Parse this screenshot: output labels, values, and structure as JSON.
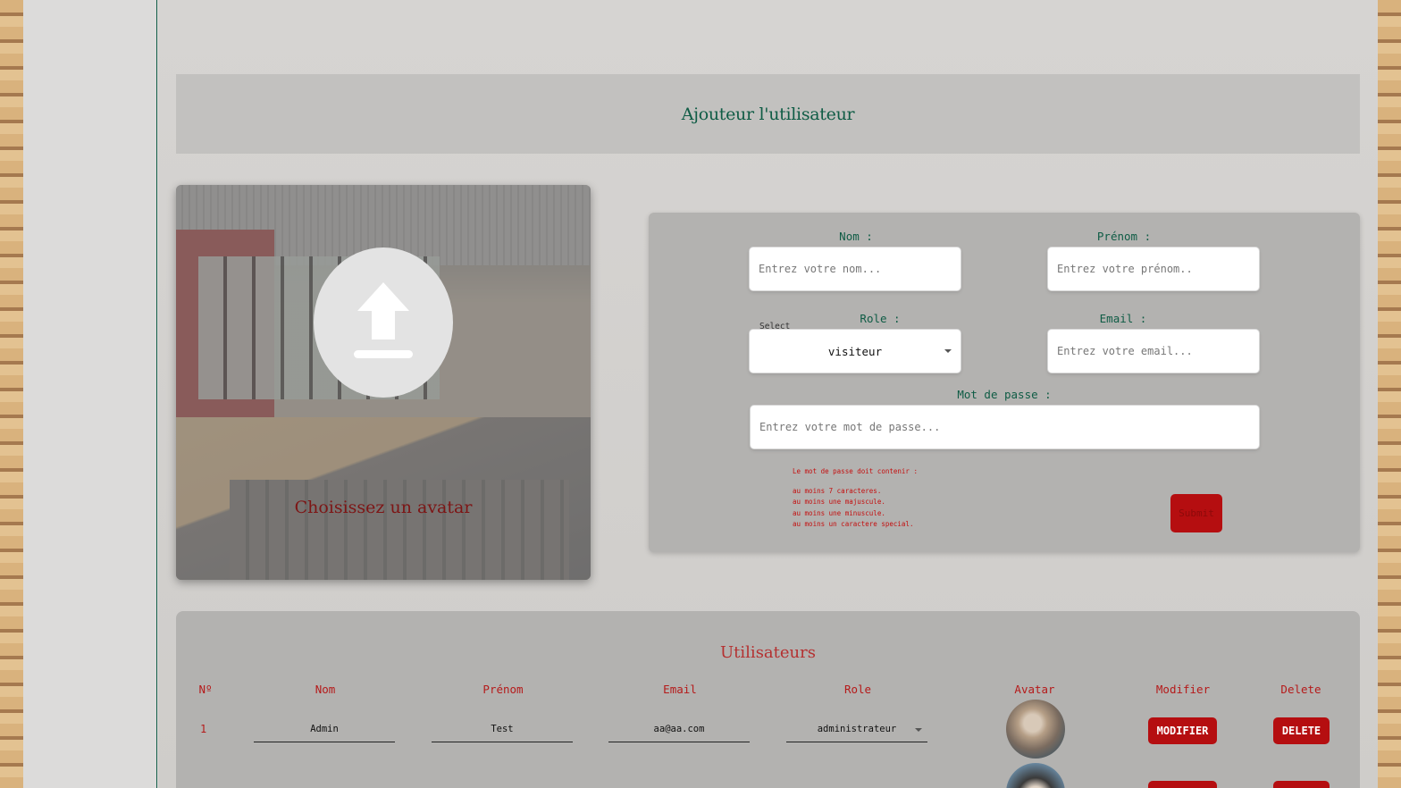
{
  "form_section": {
    "title": "Ajouteur l'utilisateur",
    "avatar_label": "Choisissez un avatar",
    "labels": {
      "nom": "Nom :",
      "prenom": "Prénom :",
      "role": "Role :",
      "email": "Email :",
      "password": "Mot de passe :"
    },
    "placeholders": {
      "nom": "Entrez votre nom...",
      "prenom": "Entrez votre prénom..",
      "email": "Entrez votre email...",
      "password": "Entrez votre mot de passe..."
    },
    "role_select": {
      "tiny_label": "Select",
      "value": "visiteur"
    },
    "password_rules": {
      "intro": "Le mot de passe doit contenir :",
      "items": [
        "au moins 7 caracteres.",
        "au moins une majuscule.",
        "au moins une minuscule.",
        "au moins un caractere special."
      ]
    },
    "submit_label": "Submit"
  },
  "users_section": {
    "title": "Utilisateurs",
    "columns": [
      "Nº",
      "Nom",
      "Prénom",
      "Email",
      "Role",
      "Avatar",
      "Modifier",
      "Delete"
    ],
    "rows": [
      {
        "num": "1",
        "nom": "Admin",
        "prenom": "Test",
        "email": "aa@aa.com",
        "role": "administrateur",
        "modify_label": "MODIFIER",
        "delete_label": "DELETE"
      }
    ]
  },
  "colors": {
    "accent_green": "#0f5c45",
    "accent_red": "#b50e10",
    "card_gray": "#b3b2b0"
  },
  "icons": {
    "upload": "upload-icon"
  }
}
